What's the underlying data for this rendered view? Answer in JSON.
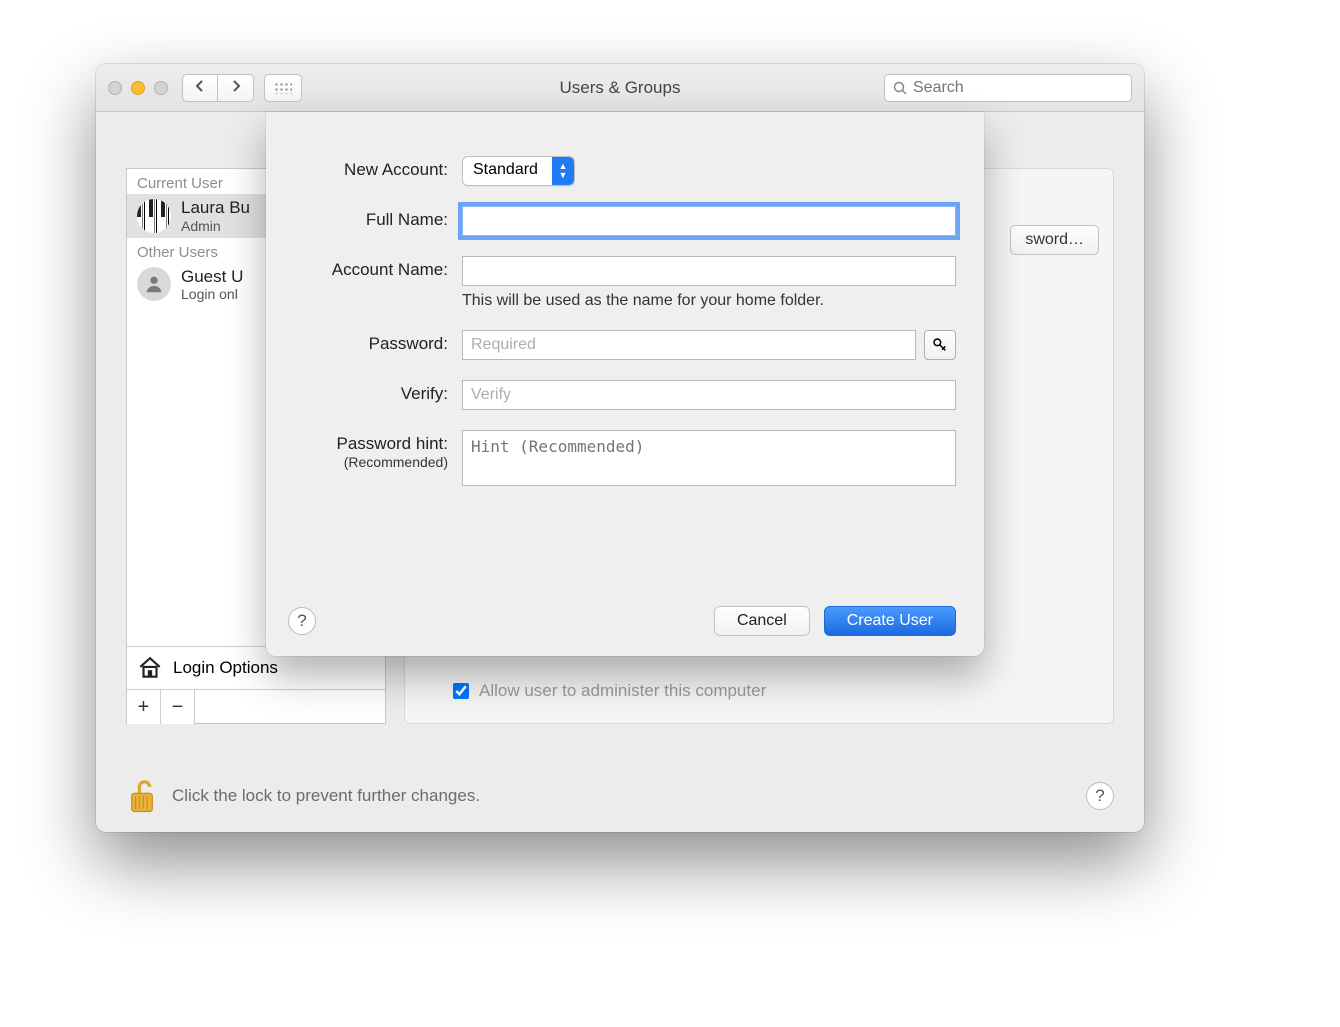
{
  "window": {
    "title": "Users & Groups",
    "search_placeholder": "Search"
  },
  "sidebar": {
    "current_label": "Current User",
    "other_label": "Other Users",
    "users": [
      {
        "name": "Laura Bu",
        "role": "Admin",
        "avatar": "piano",
        "selected": true
      },
      {
        "name": "Guest U",
        "role": "Login onl",
        "avatar": "guest",
        "selected": false
      }
    ],
    "login_options": "Login Options"
  },
  "main": {
    "change_password_btn": "sword…",
    "admin_checkbox": "Allow user to administer this computer",
    "admin_checked": true
  },
  "footer": {
    "lock_text": "Click the lock to prevent further changes."
  },
  "sheet": {
    "new_account_label": "New Account:",
    "new_account_value": "Standard",
    "full_name_label": "Full Name:",
    "account_name_label": "Account Name:",
    "account_name_caption": "This will be used as the name for your home folder.",
    "password_label": "Password:",
    "password_placeholder": "Required",
    "verify_label": "Verify:",
    "verify_placeholder": "Verify",
    "hint_label": "Password hint:",
    "hint_sub": "(Recommended)",
    "hint_placeholder": "Hint (Recommended)",
    "cancel": "Cancel",
    "create": "Create User"
  }
}
